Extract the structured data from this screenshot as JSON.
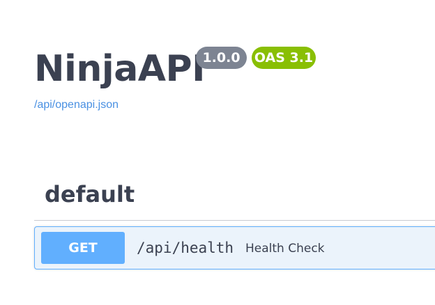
{
  "info": {
    "title": "NinjaAPI",
    "version": "1.0.0",
    "oas_badge": "OAS 3.1",
    "spec_url": "/api/openapi.json"
  },
  "tags": [
    {
      "name": "default",
      "operations": [
        {
          "method": "GET",
          "path": "/api/health",
          "summary": "Health Check"
        }
      ]
    }
  ],
  "colors": {
    "title": "#3b4151",
    "version_badge": "#7d8492",
    "oas_badge": "#89bf04",
    "link": "#4990e2",
    "get_method": "#61affe",
    "get_background": "#ebf3fb"
  }
}
